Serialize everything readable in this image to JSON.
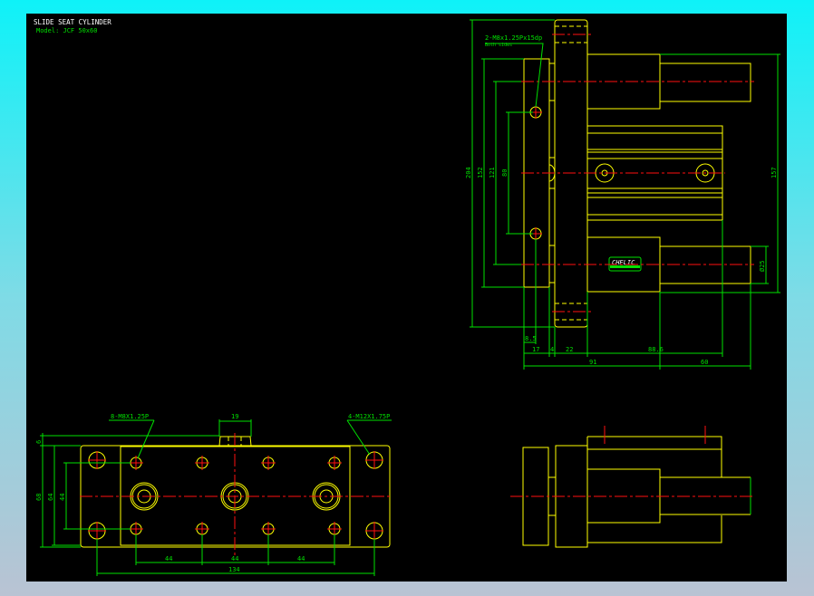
{
  "title": "SLIDE SEAT CYLINDER",
  "model": "Model: JCF 50x60",
  "colors": {
    "outline": "#ffff00",
    "dimension": "#00e000",
    "centerline": "#ff1010",
    "background": "#000000"
  },
  "side_view": {
    "thread_note": "2-M8x1.25Px15dp",
    "thread_note_sub": "Both sides",
    "logo": "CHELIC",
    "dims": {
      "d204": "204",
      "d152": "152",
      "d121": "121",
      "d80": "80",
      "d157": "157",
      "d25": "Ø25",
      "d8_5": "8.5",
      "d17": "17",
      "d4": "4",
      "d22": "22",
      "d88_6": "88.6",
      "d91": "91",
      "d60": "60"
    }
  },
  "top_view": {
    "thread_note_left": "8-M8X1.25P",
    "thread_note_right": "4-M12X1.75P",
    "dims": {
      "d19": "19",
      "d6": "6",
      "d68": "68",
      "d64": "64",
      "d44v": "44",
      "d44a": "44",
      "d44b": "44",
      "d44c": "44",
      "d134": "134"
    }
  }
}
